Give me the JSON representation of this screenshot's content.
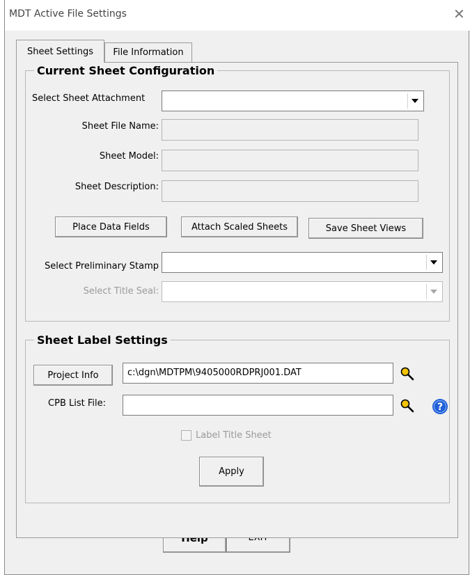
{
  "window": {
    "title": "MDT Active File Settings",
    "close_glyph": "✕"
  },
  "tabs": [
    {
      "label": "Sheet Settings",
      "active": true
    },
    {
      "label": "File Information",
      "active": false
    }
  ],
  "current_sheet_configuration": {
    "legend": "Current Sheet Configuration",
    "select_sheet_attachment_label": "Select Sheet Attachment",
    "select_sheet_attachment_value": "",
    "sheet_file_name_label": "Sheet File Name:",
    "sheet_file_name_value": "",
    "sheet_model_label": "Sheet Model:",
    "sheet_model_value": "",
    "sheet_description_label": "Sheet Description:",
    "sheet_description_value": "",
    "place_data_fields_label": "Place Data Fields",
    "attach_scaled_sheets_label": "Attach Scaled Sheets",
    "save_sheet_views_label": "Save Sheet Views",
    "select_preliminary_stamp_label": "Select Preliminary Stamp",
    "select_preliminary_stamp_value": "",
    "select_title_seal_label": "Select Title Seal:",
    "select_title_seal_value": ""
  },
  "sheet_label_settings": {
    "legend": "Sheet Label Settings",
    "project_info_label": "Project Info",
    "project_info_path": "c:\\dgn\\MDTPM\\9405000RDPRJ001.DAT",
    "cpb_list_file_label": "CPB List File:",
    "cpb_list_file_value": "",
    "label_title_sheet_label": "Label Title Sheet",
    "label_title_sheet_checked": false,
    "apply_label": "Apply"
  },
  "footer": {
    "help_label": "Help",
    "exit_label": "EXIT"
  },
  "colors": {
    "window_bg": "#f0f0f0",
    "help_icon_blue": "#1f5fd6",
    "search_icon_yellow": "#f2c400"
  }
}
